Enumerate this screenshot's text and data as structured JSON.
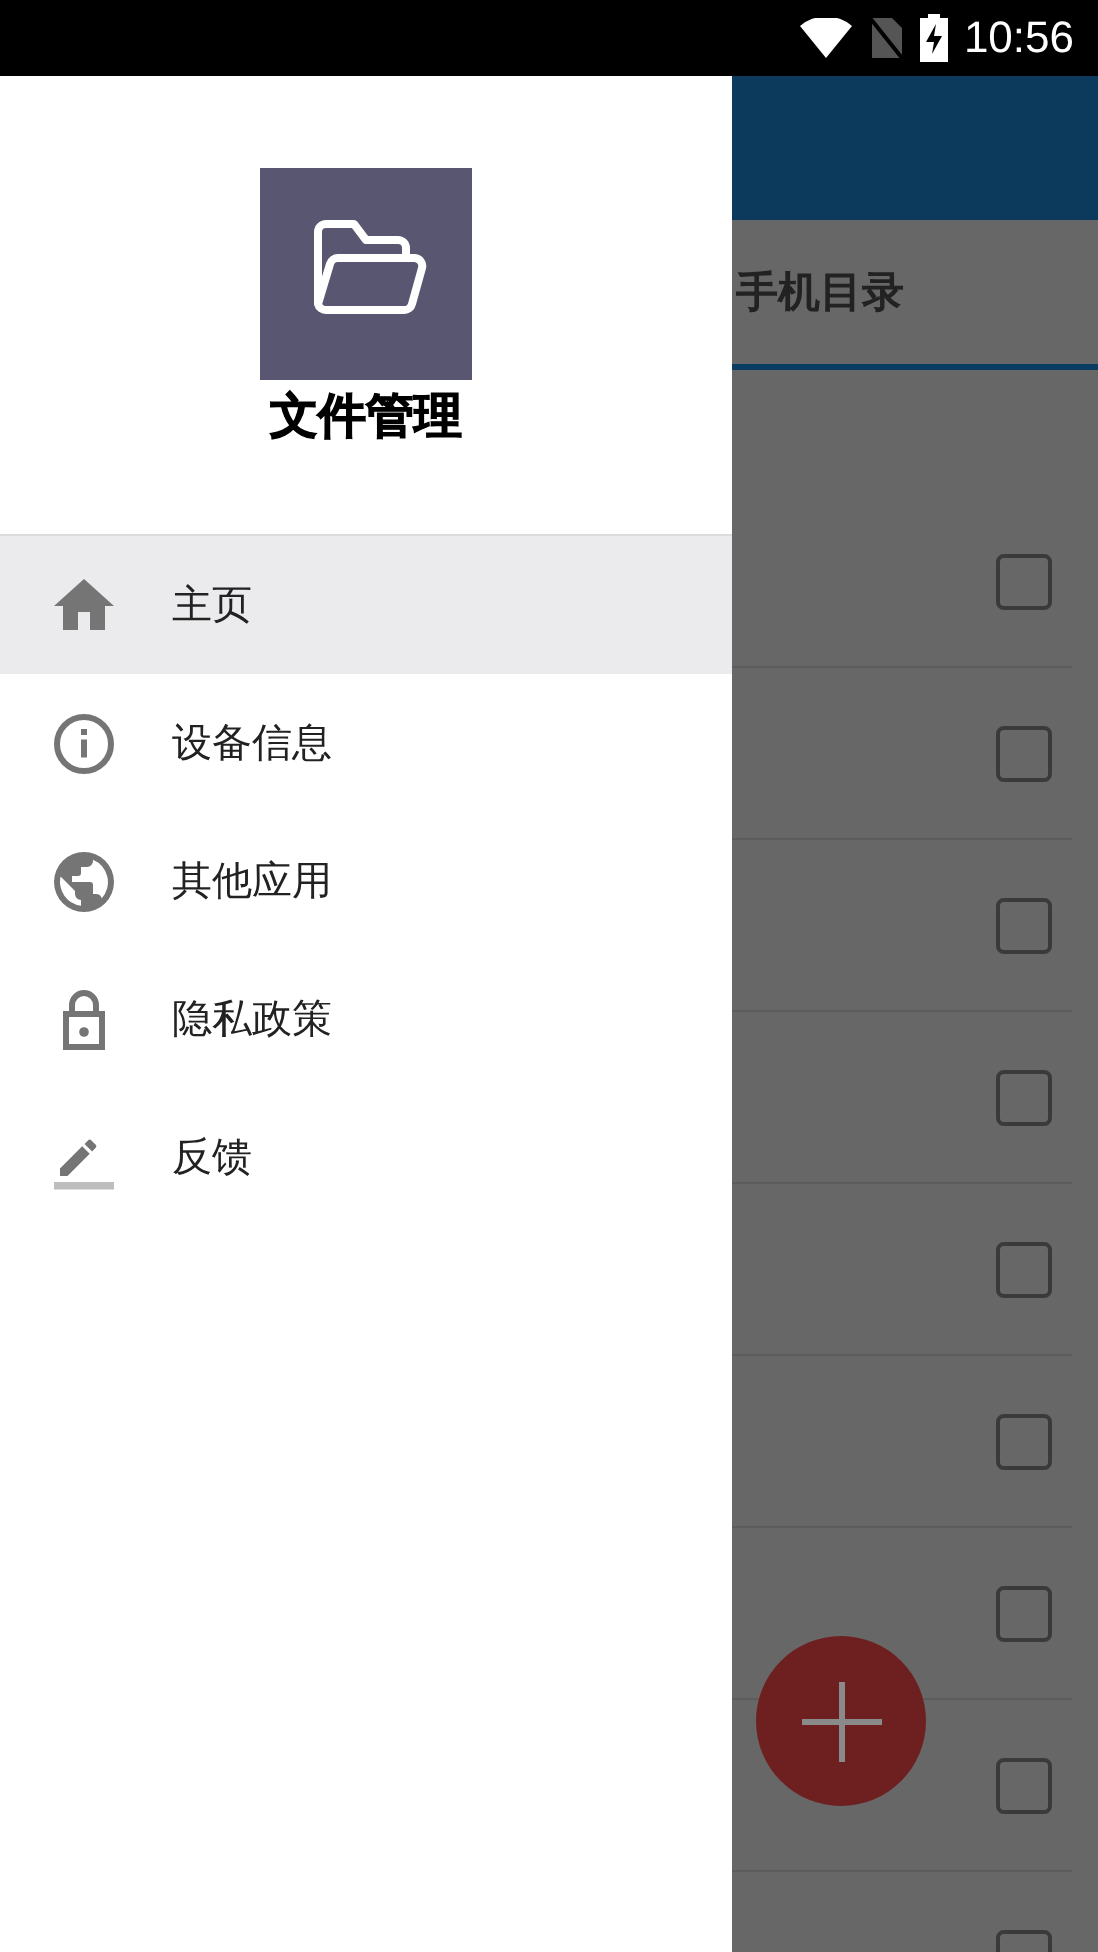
{
  "status_bar": {
    "time": "10:56"
  },
  "drawer": {
    "app_name": "文件管理",
    "items": [
      {
        "kind": "home",
        "label": "主页",
        "selected": true
      },
      {
        "kind": "info",
        "label": "设备信息",
        "selected": false
      },
      {
        "kind": "globe",
        "label": "其他应用",
        "selected": false
      },
      {
        "kind": "lock",
        "label": "隐私政策",
        "selected": false
      },
      {
        "kind": "edit",
        "label": "反馈",
        "selected": false
      }
    ]
  },
  "background_screen": {
    "tab": "手机目录",
    "rows": [
      {
        "checked": false
      },
      {
        "checked": false
      },
      {
        "checked": false
      },
      {
        "checked": false
      },
      {
        "checked": false
      },
      {
        "checked": false
      },
      {
        "checked": false
      },
      {
        "checked": false
      },
      {
        "checked": false
      }
    ]
  }
}
